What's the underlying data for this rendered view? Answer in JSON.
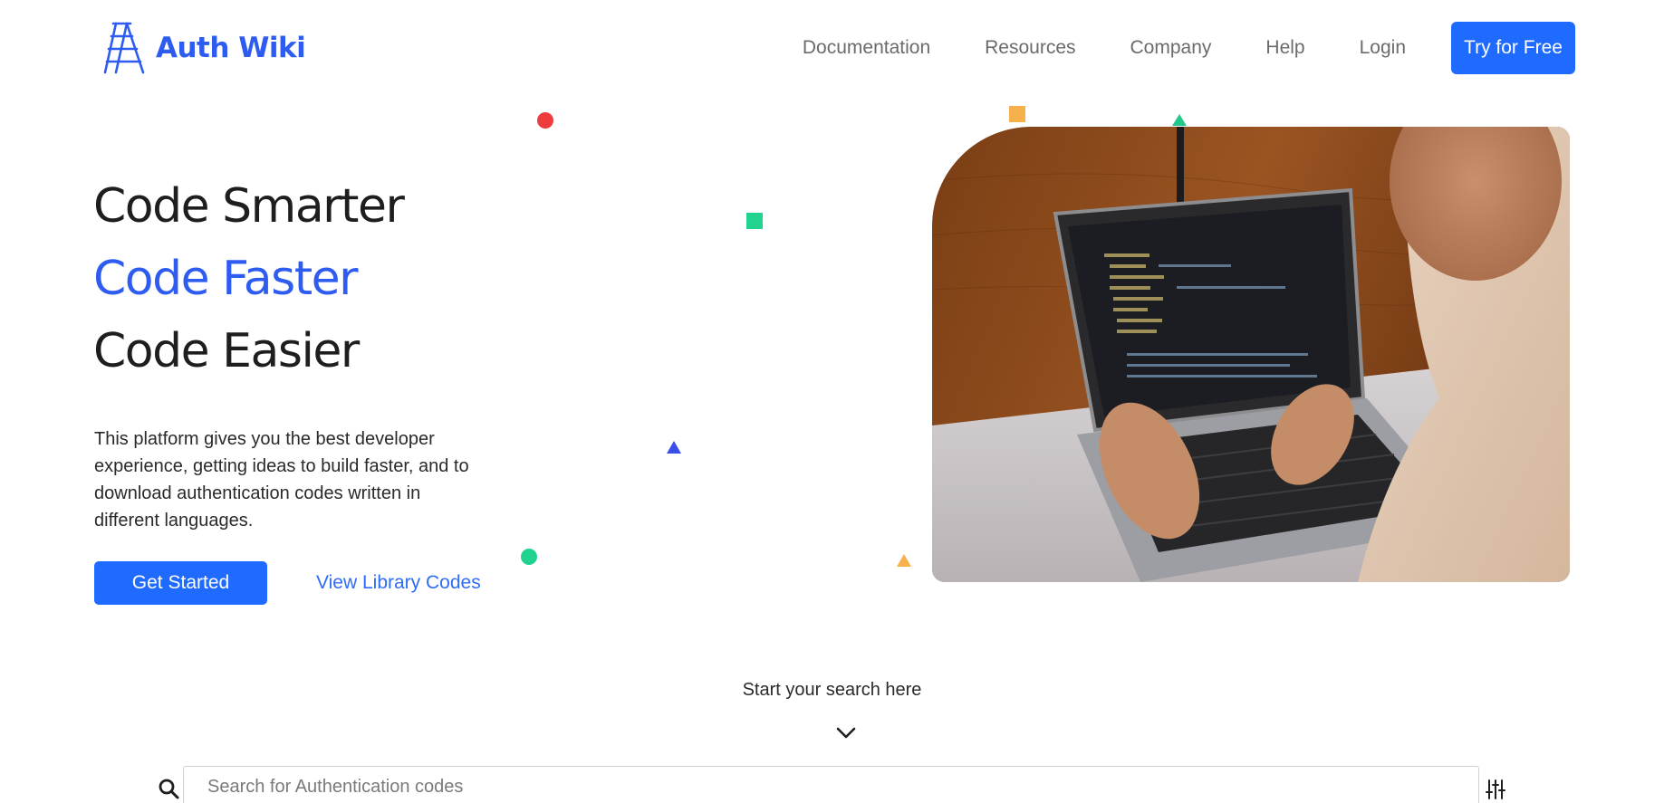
{
  "header": {
    "brand": "Auth Wiki",
    "logo_icon": "ladder-icon",
    "nav": [
      "Documentation",
      "Resources",
      "Company",
      "Help",
      "Login"
    ],
    "cta": "Try for Free"
  },
  "hero": {
    "line1": "Code Smarter",
    "line2": "Code Faster",
    "line3": "Code Easier",
    "description": "This platform gives you the best developer experience, getting ideas to build faster, and to download authentication codes written in different languages.",
    "primary_button": "Get Started",
    "secondary_link": "View Library Codes",
    "image_icon": "laptop-coding-photo"
  },
  "search": {
    "hint": "Start your search here",
    "placeholder": "Search for Authentication codes",
    "search_icon": "search-icon",
    "filter_icon": "sliders-icon",
    "chevron_icon": "chevron-down-icon"
  },
  "colors": {
    "brand_blue": "#2f5cf0",
    "button_blue": "#1f6bff",
    "text_dark": "#1e1e1e",
    "nav_gray": "#6b6b6b",
    "shape_red": "#ee3b3b",
    "shape_green": "#22d38f",
    "shape_orange": "#f6b04c",
    "shape_blue": "#3a4fe6"
  }
}
